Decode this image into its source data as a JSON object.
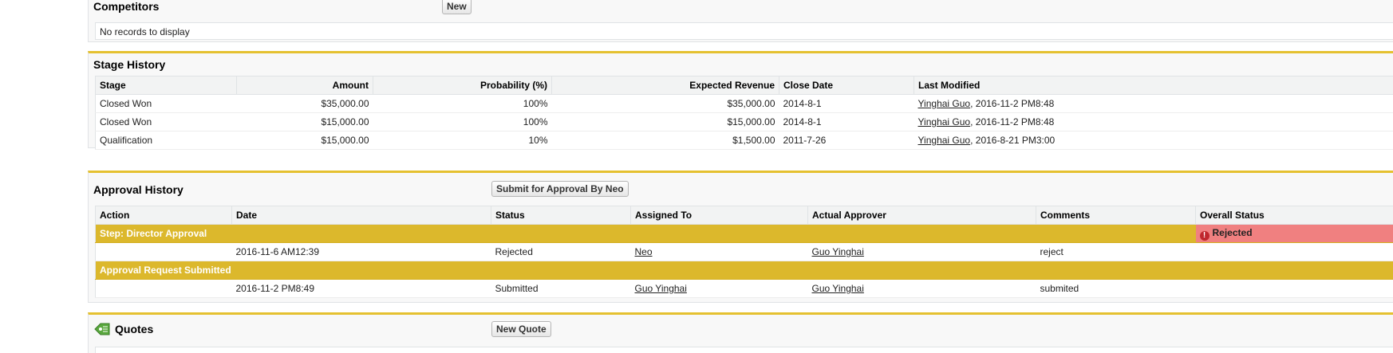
{
  "competitors": {
    "title": "Competitors",
    "new_button": "New",
    "empty_text": "No records to display"
  },
  "stage_history": {
    "title": "Stage History",
    "columns": [
      "Stage",
      "Amount",
      "Probability (%)",
      "Expected Revenue",
      "Close Date",
      "Last Modified"
    ],
    "rows": [
      {
        "stage": "Closed Won",
        "amount": "$35,000.00",
        "probability": "100%",
        "expected_revenue": "$35,000.00",
        "close_date": "2014-8-1",
        "modified_by": "Yinghai Guo",
        "modified_at": ", 2016-11-2 PM8:48"
      },
      {
        "stage": "Closed Won",
        "amount": "$15,000.00",
        "probability": "100%",
        "expected_revenue": "$15,000.00",
        "close_date": "2014-8-1",
        "modified_by": "Yinghai Guo",
        "modified_at": ", 2016-11-2 PM8:48"
      },
      {
        "stage": "Qualification",
        "amount": "$15,000.00",
        "probability": "10%",
        "expected_revenue": "$1,500.00",
        "close_date": "2011-7-26",
        "modified_by": "Yinghai Guo",
        "modified_at": ", 2016-8-21 PM3:00"
      }
    ]
  },
  "approval_history": {
    "title": "Approval History",
    "submit_button": "Submit for Approval By Neo",
    "columns": [
      "Action",
      "Date",
      "Status",
      "Assigned To",
      "Actual Approver",
      "Comments",
      "Overall Status"
    ],
    "step1": {
      "label": "Step: Director Approval",
      "overall_status": "Rejected",
      "row": {
        "date": "2016-11-6 AM12:39",
        "status": "Rejected",
        "assigned_to": "Neo",
        "actual_approver": "Guo Yinghai",
        "comments": "reject"
      }
    },
    "step2": {
      "label": "Approval Request Submitted",
      "row": {
        "date": "2016-11-2 PM8:49",
        "status": "Submitted",
        "assigned_to": "Guo Yinghai",
        "actual_approver": "Guo Yinghai",
        "comments": "submited"
      }
    }
  },
  "quotes": {
    "title": "Quotes",
    "new_button": "New Quote",
    "icon": "price-tag-icon"
  },
  "colors": {
    "section_border": "#e5c130",
    "step_row": "#dcb82c",
    "rejected_bg": "#f08080",
    "link": "#015ba7"
  }
}
